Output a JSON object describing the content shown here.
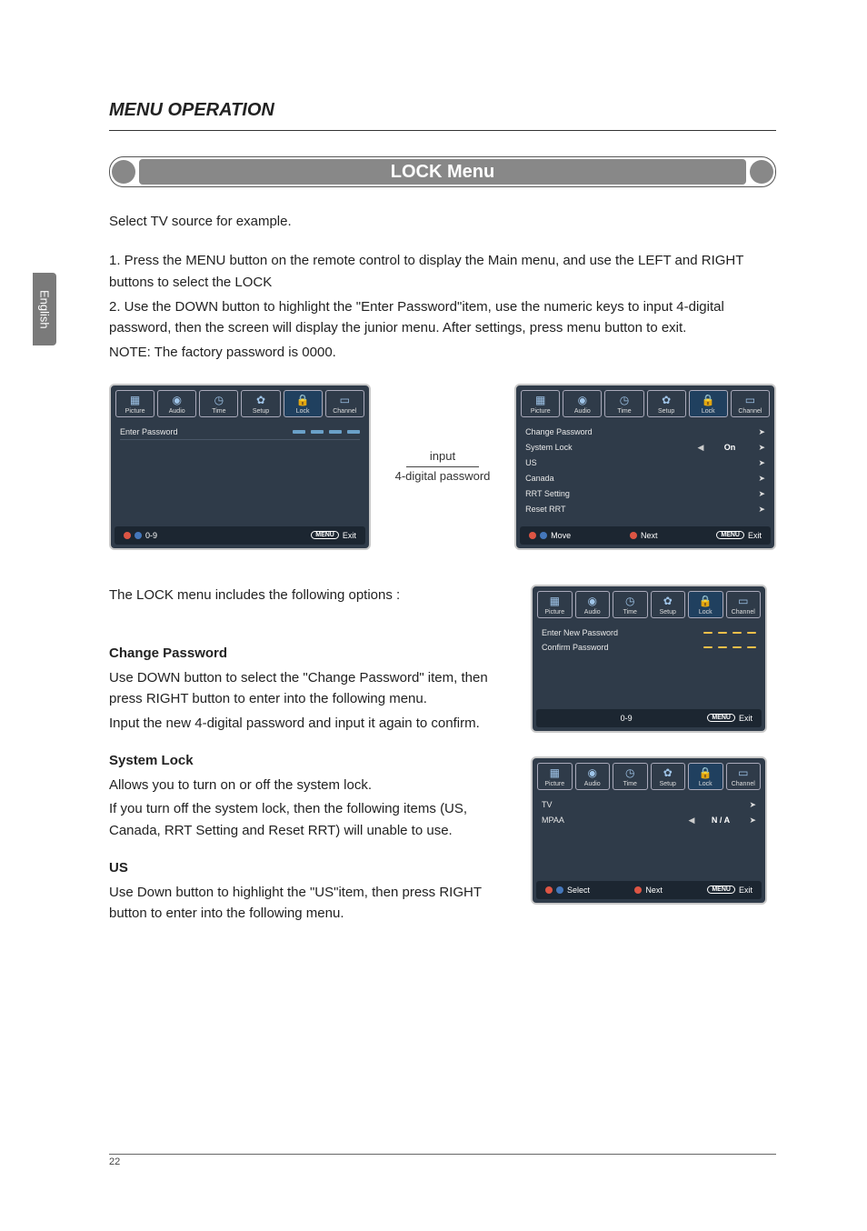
{
  "side_tab": "English",
  "page_title": "MENU OPERATION",
  "banner": "LOCK Menu",
  "intro": "Select TV source for example.",
  "steps": [
    "1. Press the MENU button on the remote control to display the Main menu, and use the LEFT and RIGHT buttons to select the LOCK",
    "2. Use the DOWN button to highlight the \"Enter Password\"item, use the numeric keys to input 4-digital password, then the screen will display the junior menu. After settings, press menu button to exit.",
    "NOTE: The factory password is 0000."
  ],
  "osd_tabs": [
    "Picture",
    "Audio",
    "Time",
    "Setup",
    "Lock",
    "Channel"
  ],
  "tab_icons": [
    "▦",
    "◉",
    "◷",
    "✿",
    "🔒",
    "▭"
  ],
  "between_label_line1": "input",
  "between_label_line2": "4-digital password",
  "osd1": {
    "row": "Enter Password",
    "footer_left": "0-9",
    "footer_menu": "MENU",
    "footer_right": "Exit"
  },
  "osd2": {
    "items": [
      {
        "label": "Change Password",
        "mid": "",
        "val": "",
        "arrow": "➤"
      },
      {
        "label": "System Lock",
        "mid": "◀",
        "val": "On",
        "arrow": "➤"
      },
      {
        "label": "US",
        "mid": "",
        "val": "",
        "arrow": "➤"
      },
      {
        "label": "Canada",
        "mid": "",
        "val": "",
        "arrow": "➤"
      },
      {
        "label": "RRT Setting",
        "mid": "",
        "val": "",
        "arrow": "➤"
      },
      {
        "label": "Reset RRT",
        "mid": "",
        "val": "",
        "arrow": "➤"
      }
    ],
    "footer_left": "Move",
    "footer_mid": "Next",
    "footer_menu": "MENU",
    "footer_right": "Exit"
  },
  "osd3": {
    "row1": "Enter New Password",
    "row2": "Confirm Password",
    "footer_left": "0-9",
    "footer_menu": "MENU",
    "footer_right": "Exit"
  },
  "osd4": {
    "items": [
      {
        "label": "TV",
        "mid": "",
        "val": "",
        "arrow": "➤"
      },
      {
        "label": "MPAA",
        "mid": "◀",
        "val": "N / A",
        "arrow": "➤"
      }
    ],
    "footer_left": "Select",
    "footer_mid": "Next",
    "footer_menu": "MENU",
    "footer_right": "Exit"
  },
  "left_intro": "The LOCK menu includes the following options :",
  "sections": [
    {
      "h": "Change Password",
      "p": [
        "Use DOWN button to select the \"Change Password\" item, then press RIGHT button to enter into the following menu.",
        "Input the new 4-digital password and input it again to confirm."
      ]
    },
    {
      "h": "System Lock",
      "p": [
        "Allows you to turn on or off the system lock.",
        "If you turn off the system lock, then the following items (US, Canada, RRT Setting and Reset RRT) will unable to use."
      ]
    },
    {
      "h": "US",
      "p": [
        "Use Down button to highlight the \"US\"item, then press RIGHT button to enter into the following menu."
      ]
    }
  ],
  "page_number": "22"
}
